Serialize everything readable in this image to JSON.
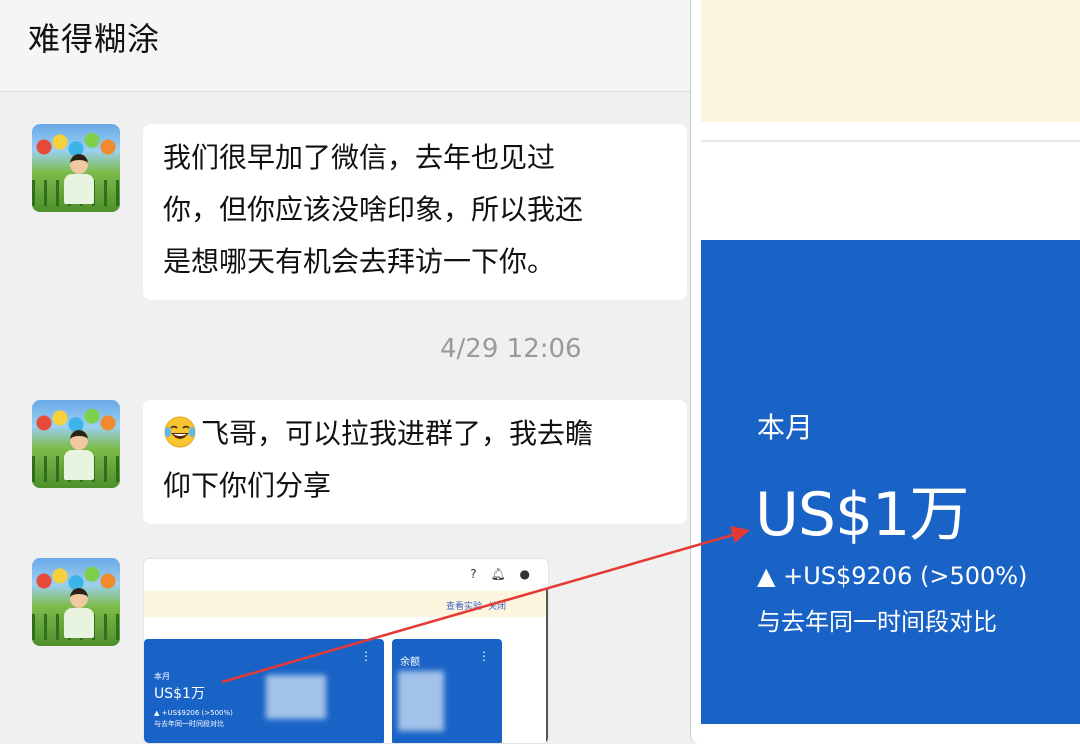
{
  "chat": {
    "title": "难得糊涂",
    "messages": [
      {
        "type": "text",
        "lines": [
          "我们很早加了微信，去年也见过",
          "你，但你应该没啥印象，所以我还",
          "是想哪天有机会去拜访一下你。"
        ]
      },
      {
        "type": "timestamp",
        "text": "4/29 12:06"
      },
      {
        "type": "text",
        "emoji": "laughing-with-tears-emoji",
        "lines": [
          "飞哥，可以拉我进群了，我去瞻",
          "仰下你们分享"
        ]
      },
      {
        "type": "image"
      }
    ]
  },
  "screenshot_thumb": {
    "notice_link_1": "查看实验",
    "notice_link_2": "关闭",
    "card_month": {
      "label": "本月",
      "value": "US$1万",
      "change": "▲ +US$9206 (>500%)",
      "compare": "与去年同一时间段对比"
    },
    "card_balance": {
      "label": "余额"
    },
    "menu_glyph": "⋮"
  },
  "zoom": {
    "label": "本月",
    "value": "US$1万",
    "change": "▲ +US$9206 (>500%)",
    "compare": "与去年同一时间段对比"
  },
  "colors": {
    "card_blue": "#1a63c6",
    "notice_bg": "#fdf5dd",
    "arrow_red": "#e53935"
  }
}
